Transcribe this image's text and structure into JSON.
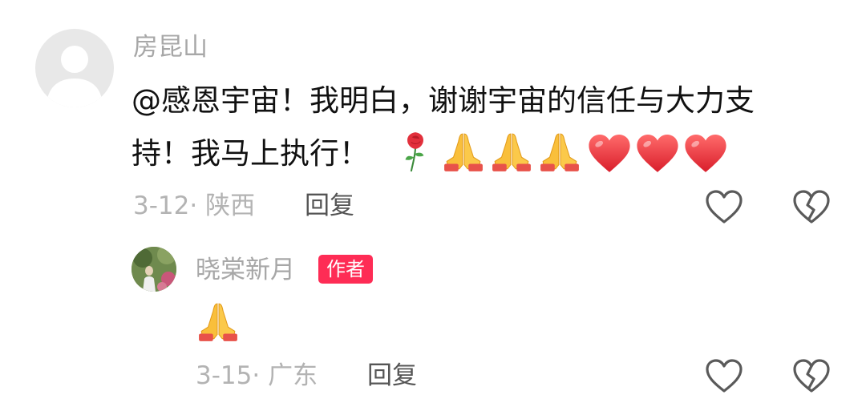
{
  "comment": {
    "username": "房昆山",
    "text_line1": "@感恩宇宙！我明白，谢谢宇宙的信任与大力支",
    "text_line2": "持！我马上执行！",
    "emojis": [
      "rose",
      "folded-hands",
      "folded-hands",
      "folded-hands",
      "red-heart",
      "red-heart",
      "red-heart"
    ],
    "meta": "3-12· 陕西",
    "reply_label": "回复",
    "icons": [
      "like-heart-icon",
      "dislike-broken-heart-icon"
    ]
  },
  "reply": {
    "username": "晓棠新月",
    "badge": "作者",
    "emojis": [
      "folded-hands"
    ],
    "meta": "3-15· 广东",
    "reply_label": "回复",
    "icons": [
      "like-heart-icon",
      "dislike-broken-heart-icon"
    ]
  },
  "colors": {
    "badge_bg": "#fe2c55",
    "username": "#a7a7a7",
    "meta": "#b3b3b3",
    "heart_red": "#f23a45",
    "hands_yellow": "#f9bf3b"
  }
}
